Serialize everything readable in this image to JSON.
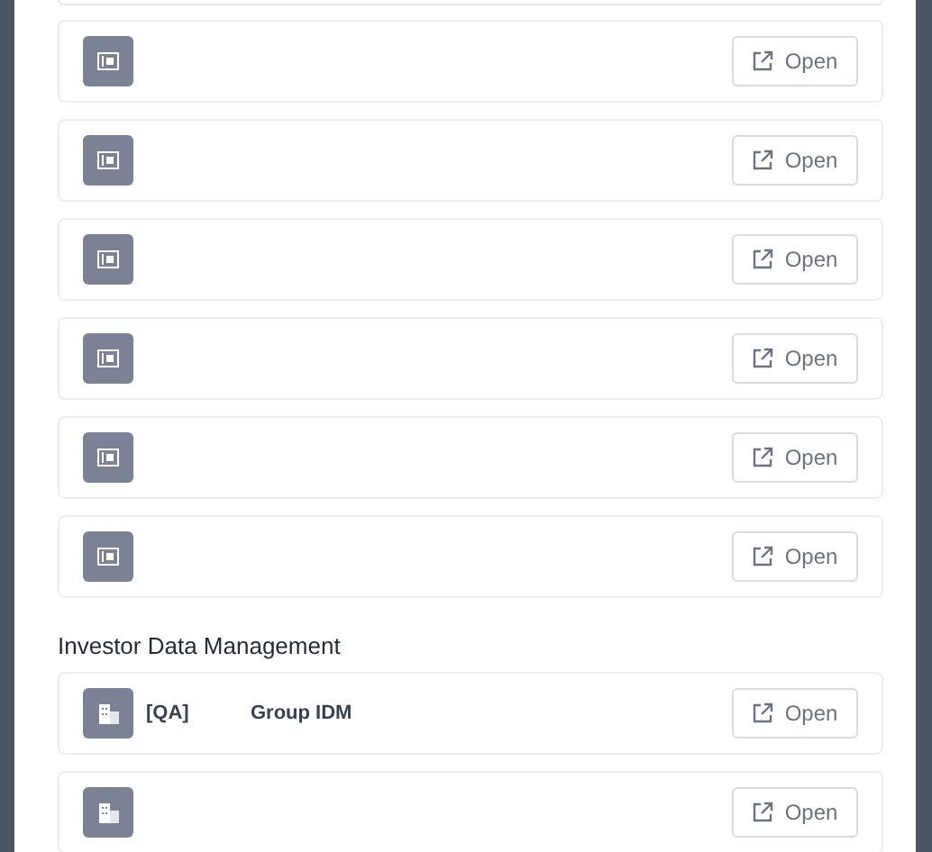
{
  "sections": [
    {
      "items": [
        {
          "kind": "ticket",
          "action": "Open"
        },
        {
          "kind": "ticket",
          "action": "Open"
        },
        {
          "kind": "ticket",
          "action": "Open"
        },
        {
          "kind": "ticket",
          "action": "Open"
        },
        {
          "kind": "ticket",
          "action": "Open"
        },
        {
          "kind": "ticket",
          "action": "Open"
        }
      ]
    },
    {
      "title": "Investor Data Management",
      "items": [
        {
          "kind": "building",
          "tag": "[QA]",
          "name": "Group IDM",
          "action": "Open"
        },
        {
          "kind": "building",
          "action": "Open"
        }
      ]
    }
  ]
}
